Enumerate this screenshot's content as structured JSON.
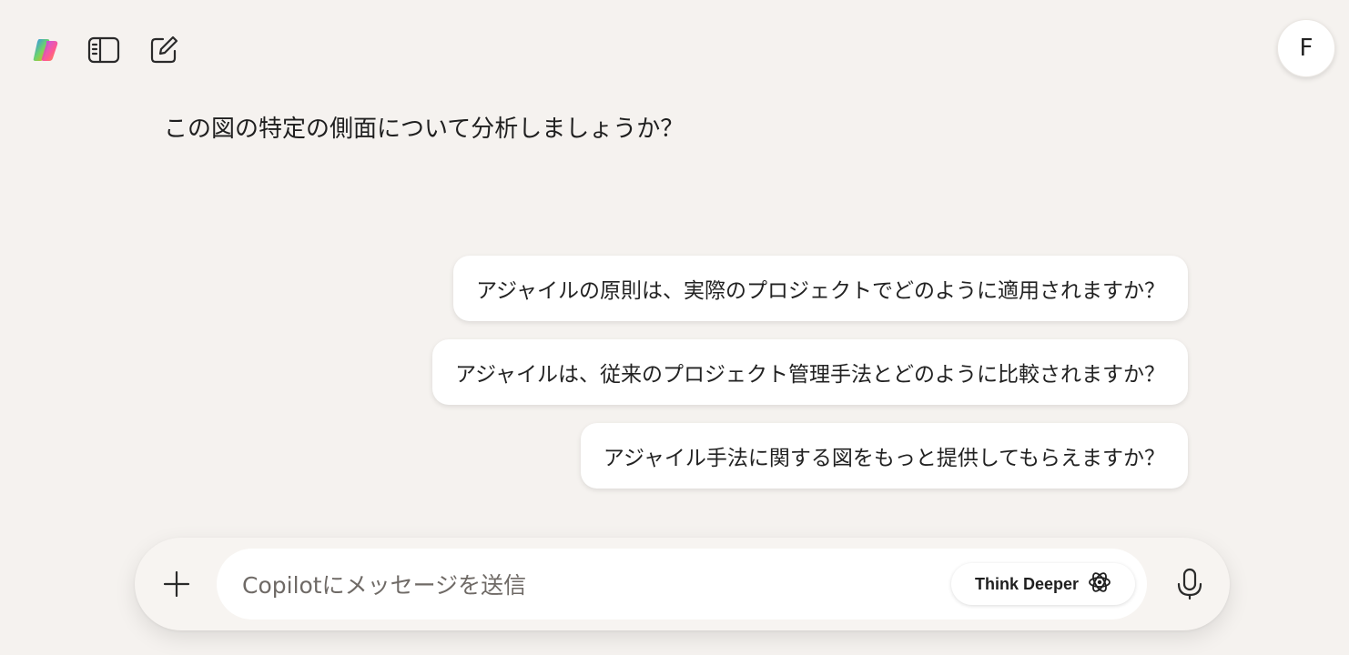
{
  "header": {
    "avatar_initial": "F"
  },
  "assistant": {
    "message": "この図の特定の側面について分析しましょうか？"
  },
  "suggestions": [
    {
      "label": "アジャイルの原則は、実際のプロジェクトでどのように適用されますか？"
    },
    {
      "label": "アジャイルは、従来のプロジェクト管理手法とどのように比較されますか？"
    },
    {
      "label": "アジャイル手法に関する図をもっと提供してもらえますか？"
    }
  ],
  "composer": {
    "placeholder": "Copilotにメッセージを送信",
    "value": "",
    "think_deeper_label": "Think Deeper"
  },
  "icons": {
    "logo": "copilot-logo-icon",
    "sidebar": "sidebar-toggle-icon",
    "new_chat": "new-chat-icon",
    "attach": "plus-icon",
    "think": "think-deeper-icon",
    "mic": "microphone-icon"
  }
}
